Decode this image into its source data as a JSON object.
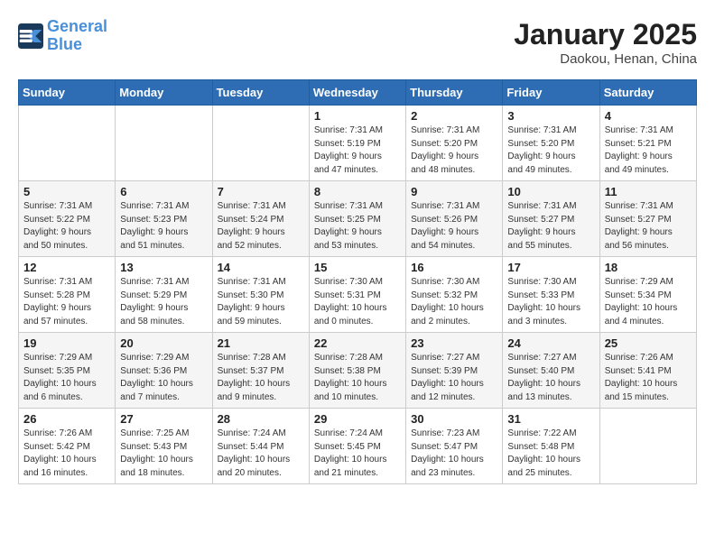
{
  "header": {
    "logo_line1": "General",
    "logo_line2": "Blue",
    "month": "January 2025",
    "location": "Daokou, Henan, China"
  },
  "weekdays": [
    "Sunday",
    "Monday",
    "Tuesday",
    "Wednesday",
    "Thursday",
    "Friday",
    "Saturday"
  ],
  "weeks": [
    [
      {
        "day": "",
        "info": ""
      },
      {
        "day": "",
        "info": ""
      },
      {
        "day": "",
        "info": ""
      },
      {
        "day": "1",
        "info": "Sunrise: 7:31 AM\nSunset: 5:19 PM\nDaylight: 9 hours\nand 47 minutes."
      },
      {
        "day": "2",
        "info": "Sunrise: 7:31 AM\nSunset: 5:20 PM\nDaylight: 9 hours\nand 48 minutes."
      },
      {
        "day": "3",
        "info": "Sunrise: 7:31 AM\nSunset: 5:20 PM\nDaylight: 9 hours\nand 49 minutes."
      },
      {
        "day": "4",
        "info": "Sunrise: 7:31 AM\nSunset: 5:21 PM\nDaylight: 9 hours\nand 49 minutes."
      }
    ],
    [
      {
        "day": "5",
        "info": "Sunrise: 7:31 AM\nSunset: 5:22 PM\nDaylight: 9 hours\nand 50 minutes."
      },
      {
        "day": "6",
        "info": "Sunrise: 7:31 AM\nSunset: 5:23 PM\nDaylight: 9 hours\nand 51 minutes."
      },
      {
        "day": "7",
        "info": "Sunrise: 7:31 AM\nSunset: 5:24 PM\nDaylight: 9 hours\nand 52 minutes."
      },
      {
        "day": "8",
        "info": "Sunrise: 7:31 AM\nSunset: 5:25 PM\nDaylight: 9 hours\nand 53 minutes."
      },
      {
        "day": "9",
        "info": "Sunrise: 7:31 AM\nSunset: 5:26 PM\nDaylight: 9 hours\nand 54 minutes."
      },
      {
        "day": "10",
        "info": "Sunrise: 7:31 AM\nSunset: 5:27 PM\nDaylight: 9 hours\nand 55 minutes."
      },
      {
        "day": "11",
        "info": "Sunrise: 7:31 AM\nSunset: 5:27 PM\nDaylight: 9 hours\nand 56 minutes."
      }
    ],
    [
      {
        "day": "12",
        "info": "Sunrise: 7:31 AM\nSunset: 5:28 PM\nDaylight: 9 hours\nand 57 minutes."
      },
      {
        "day": "13",
        "info": "Sunrise: 7:31 AM\nSunset: 5:29 PM\nDaylight: 9 hours\nand 58 minutes."
      },
      {
        "day": "14",
        "info": "Sunrise: 7:31 AM\nSunset: 5:30 PM\nDaylight: 9 hours\nand 59 minutes."
      },
      {
        "day": "15",
        "info": "Sunrise: 7:30 AM\nSunset: 5:31 PM\nDaylight: 10 hours\nand 0 minutes."
      },
      {
        "day": "16",
        "info": "Sunrise: 7:30 AM\nSunset: 5:32 PM\nDaylight: 10 hours\nand 2 minutes."
      },
      {
        "day": "17",
        "info": "Sunrise: 7:30 AM\nSunset: 5:33 PM\nDaylight: 10 hours\nand 3 minutes."
      },
      {
        "day": "18",
        "info": "Sunrise: 7:29 AM\nSunset: 5:34 PM\nDaylight: 10 hours\nand 4 minutes."
      }
    ],
    [
      {
        "day": "19",
        "info": "Sunrise: 7:29 AM\nSunset: 5:35 PM\nDaylight: 10 hours\nand 6 minutes."
      },
      {
        "day": "20",
        "info": "Sunrise: 7:29 AM\nSunset: 5:36 PM\nDaylight: 10 hours\nand 7 minutes."
      },
      {
        "day": "21",
        "info": "Sunrise: 7:28 AM\nSunset: 5:37 PM\nDaylight: 10 hours\nand 9 minutes."
      },
      {
        "day": "22",
        "info": "Sunrise: 7:28 AM\nSunset: 5:38 PM\nDaylight: 10 hours\nand 10 minutes."
      },
      {
        "day": "23",
        "info": "Sunrise: 7:27 AM\nSunset: 5:39 PM\nDaylight: 10 hours\nand 12 minutes."
      },
      {
        "day": "24",
        "info": "Sunrise: 7:27 AM\nSunset: 5:40 PM\nDaylight: 10 hours\nand 13 minutes."
      },
      {
        "day": "25",
        "info": "Sunrise: 7:26 AM\nSunset: 5:41 PM\nDaylight: 10 hours\nand 15 minutes."
      }
    ],
    [
      {
        "day": "26",
        "info": "Sunrise: 7:26 AM\nSunset: 5:42 PM\nDaylight: 10 hours\nand 16 minutes."
      },
      {
        "day": "27",
        "info": "Sunrise: 7:25 AM\nSunset: 5:43 PM\nDaylight: 10 hours\nand 18 minutes."
      },
      {
        "day": "28",
        "info": "Sunrise: 7:24 AM\nSunset: 5:44 PM\nDaylight: 10 hours\nand 20 minutes."
      },
      {
        "day": "29",
        "info": "Sunrise: 7:24 AM\nSunset: 5:45 PM\nDaylight: 10 hours\nand 21 minutes."
      },
      {
        "day": "30",
        "info": "Sunrise: 7:23 AM\nSunset: 5:47 PM\nDaylight: 10 hours\nand 23 minutes."
      },
      {
        "day": "31",
        "info": "Sunrise: 7:22 AM\nSunset: 5:48 PM\nDaylight: 10 hours\nand 25 minutes."
      },
      {
        "day": "",
        "info": ""
      }
    ]
  ]
}
